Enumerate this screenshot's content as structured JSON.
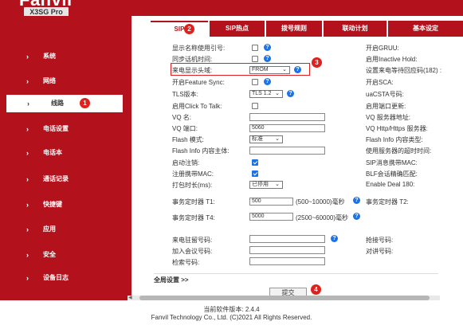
{
  "header": {
    "brand": "Fanvil",
    "model": "X3SG Pro"
  },
  "sidebar": {
    "items": [
      {
        "label": "系统"
      },
      {
        "label": "网络"
      },
      {
        "label": "线路",
        "badge": "1",
        "active": true
      },
      {
        "label": "电话设置"
      },
      {
        "label": "电话本"
      },
      {
        "label": "通话记录"
      },
      {
        "label": "快捷键"
      },
      {
        "label": "应用"
      },
      {
        "label": "安全"
      },
      {
        "label": "设备日志"
      }
    ],
    "chevron_icon": "›"
  },
  "tabs": [
    {
      "label": "SIP",
      "badge": "2",
      "active": true
    },
    {
      "label": "SIP热点"
    },
    {
      "label": "拨号规则"
    },
    {
      "label": "联动计划"
    },
    {
      "label": "基本设定"
    }
  ],
  "left_form": {
    "show_name_quote": {
      "label": "显示名称使用引号:",
      "checked": false
    },
    "sync_time": {
      "label": "同步话机时间:",
      "checked": false
    },
    "caller_id_header": {
      "label": "来电显示头域:",
      "value": "FROM",
      "badge": "3"
    },
    "feature_sync": {
      "label": "开启Feature Sync:",
      "checked": false
    },
    "tls_version": {
      "label": "TLS版本:",
      "value": "TLS 1.2"
    },
    "click_to_talk": {
      "label": "启用Click To Talk:",
      "checked": false
    },
    "vq_name": {
      "label": "VQ 名:",
      "value": ""
    },
    "vq_port": {
      "label": "VQ 端口:",
      "value": "5060"
    },
    "flash_mode": {
      "label": "Flash 模式:",
      "value": "标准"
    },
    "flash_body": {
      "label": "Flash Info 内容主体:",
      "value": ""
    },
    "enable_logout": {
      "label": "启动注销:",
      "checked": true
    },
    "register_mac": {
      "label": "注册携带MAC:",
      "checked": true
    },
    "keepalive": {
      "label": "打包时长(ms):",
      "value": "已停用"
    },
    "timer_t1": {
      "label": "事务定时器 T1:",
      "value": "500",
      "range": "(500~10000)毫秒"
    },
    "timer_t4": {
      "label": "事务定时器 T4:",
      "value": "5000",
      "range": "(2500~60000)毫秒"
    },
    "hold_number": {
      "label": "来电驻留号码:",
      "value": ""
    },
    "conference_number": {
      "label": "加入会议号码:",
      "value": ""
    },
    "search_number": {
      "label": "检索号码:",
      "value": ""
    }
  },
  "right_form": {
    "gruu": "开启GRUU:",
    "inactive_hold": "启用Inactive Hold:",
    "caller_wait_182": "设置来电等待回应码(182) :",
    "sca": "开启SCA:",
    "uacsta": "uaCSTA号码:",
    "port_update": "启用端口更新:",
    "vq_server": "VQ 服务器地址:",
    "vq_http": "VQ Http/Https 服务器:",
    "flash_type": "Flash Info 内容类型:",
    "server_timeout": "使用服务器的超时时间:",
    "sip_carry_mac": "SIP消息携带MAC:",
    "blf_match": "BLF会话精确匹配:",
    "deal_180": "Enable Deal 180:",
    "timer_t2": "事务定时器 T2:",
    "pickup_number": "抢接号码:",
    "intercom_number": "对讲号码:"
  },
  "global_settings": "全局设置 >>",
  "submit": {
    "label": "提交",
    "badge": "4"
  },
  "footer": {
    "version": "当前软件版本: 2.4.4",
    "copyright": "Fanvil Technology Co., Ltd. (C)2021 All Rights Reserved."
  },
  "colors": {
    "brand_red": "#b3121c",
    "badge_red": "#e0201c",
    "info_blue": "#1a73e8"
  },
  "icons": {
    "help": "?",
    "dropdown": "⌄"
  }
}
